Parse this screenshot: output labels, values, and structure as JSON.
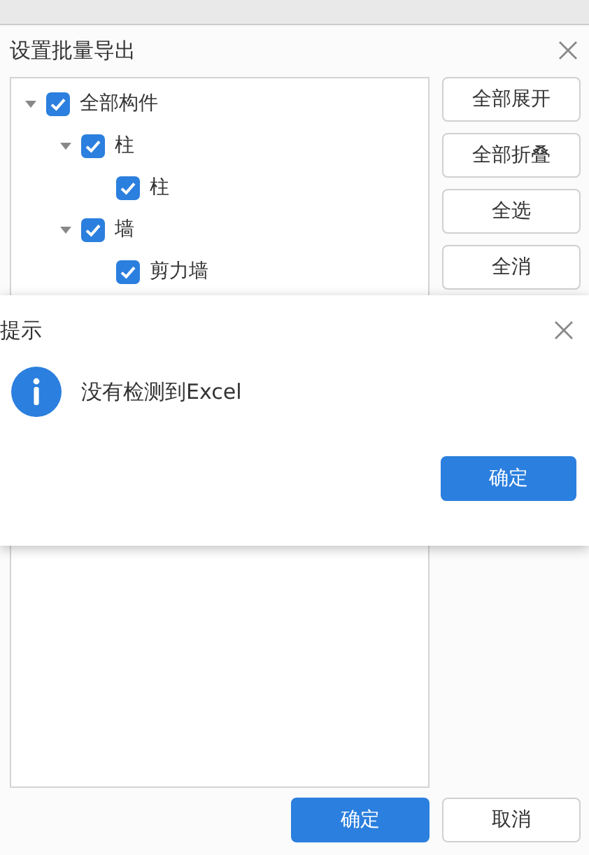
{
  "dialog": {
    "title": "设置批量导出",
    "tree": [
      {
        "label": "全部构件",
        "checked": true,
        "expanded": true,
        "children": [
          {
            "label": "柱",
            "checked": true,
            "expanded": true,
            "children": [
              {
                "label": "柱",
                "checked": true
              }
            ]
          },
          {
            "label": "墙",
            "checked": true,
            "expanded": true,
            "children": [
              {
                "label": "剪力墙",
                "checked": true
              }
            ]
          }
        ]
      }
    ],
    "side_buttons": [
      "全部展开",
      "全部折叠",
      "全选",
      "全消"
    ],
    "footer_buttons": [
      {
        "label": "确定",
        "kind": "primary"
      },
      {
        "label": "取消",
        "kind": "default"
      }
    ]
  },
  "alert": {
    "title": "提示",
    "message": "没有检测到Excel",
    "button": "确定"
  }
}
